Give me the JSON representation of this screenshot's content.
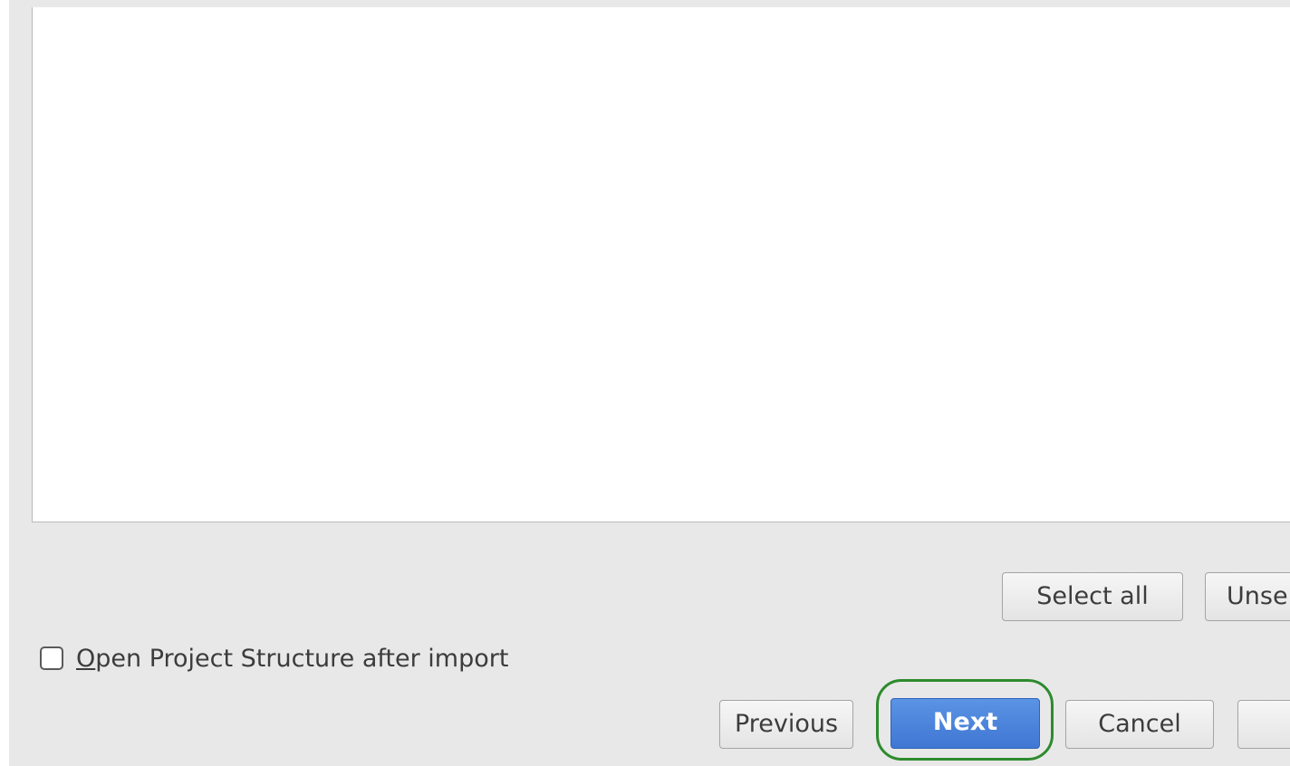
{
  "list_buttons": {
    "select_all_label": "Select all",
    "unselect_all_label": "Unse"
  },
  "options": {
    "open_structure_mnemonic": "O",
    "open_structure_rest": "pen Project Structure after import",
    "open_structure_checked": false
  },
  "footer": {
    "previous_label": "Previous",
    "next_label": "Next",
    "cancel_label": "Cancel",
    "finish_label": ""
  }
}
